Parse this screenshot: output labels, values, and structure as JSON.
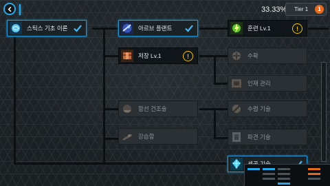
{
  "header": {
    "progress_percent": "33.33%",
    "tier_label": "Tier 1",
    "tier_badge": "1"
  },
  "nodes": {
    "styx_basic": {
      "label": "스틱스 기초 이론",
      "state": "completed",
      "icon": "brain-icon"
    },
    "arb_plant": {
      "label": "아르브 플랜트",
      "state": "completed",
      "icon": "plant-orb-icon"
    },
    "training": {
      "label": "훈련 Lv.1",
      "state": "available",
      "icon": "training-lightning-icon"
    },
    "storage": {
      "label": "저장 Lv.1",
      "state": "available",
      "icon": "storage-crate-icon"
    },
    "suhak": {
      "label": "수확",
      "state": "locked",
      "icon": "harvest-icon"
    },
    "talent_mgmt": {
      "label": "인재 관리",
      "state": "locked",
      "icon": "talent-icon"
    },
    "warship_build": {
      "label": "함선 건조술",
      "state": "locked",
      "icon": "ship-icon"
    },
    "suhyup_tech": {
      "label": "수렵 기술",
      "state": "locked",
      "icon": "hunting-icon"
    },
    "strong_ship": {
      "label": "강습함",
      "state": "locked",
      "icon": "assault-ship-icon"
    },
    "salvage_tech": {
      "label": "파견 기술",
      "state": "locked",
      "icon": "dispatch-icon"
    },
    "craft_tech": {
      "label": "세공 기술",
      "state": "completed",
      "icon": "crafting-crystal-icon"
    }
  },
  "colors": {
    "accent": "#2aa7e8",
    "alert": "#f2c400",
    "badge": "#e66a1e"
  }
}
